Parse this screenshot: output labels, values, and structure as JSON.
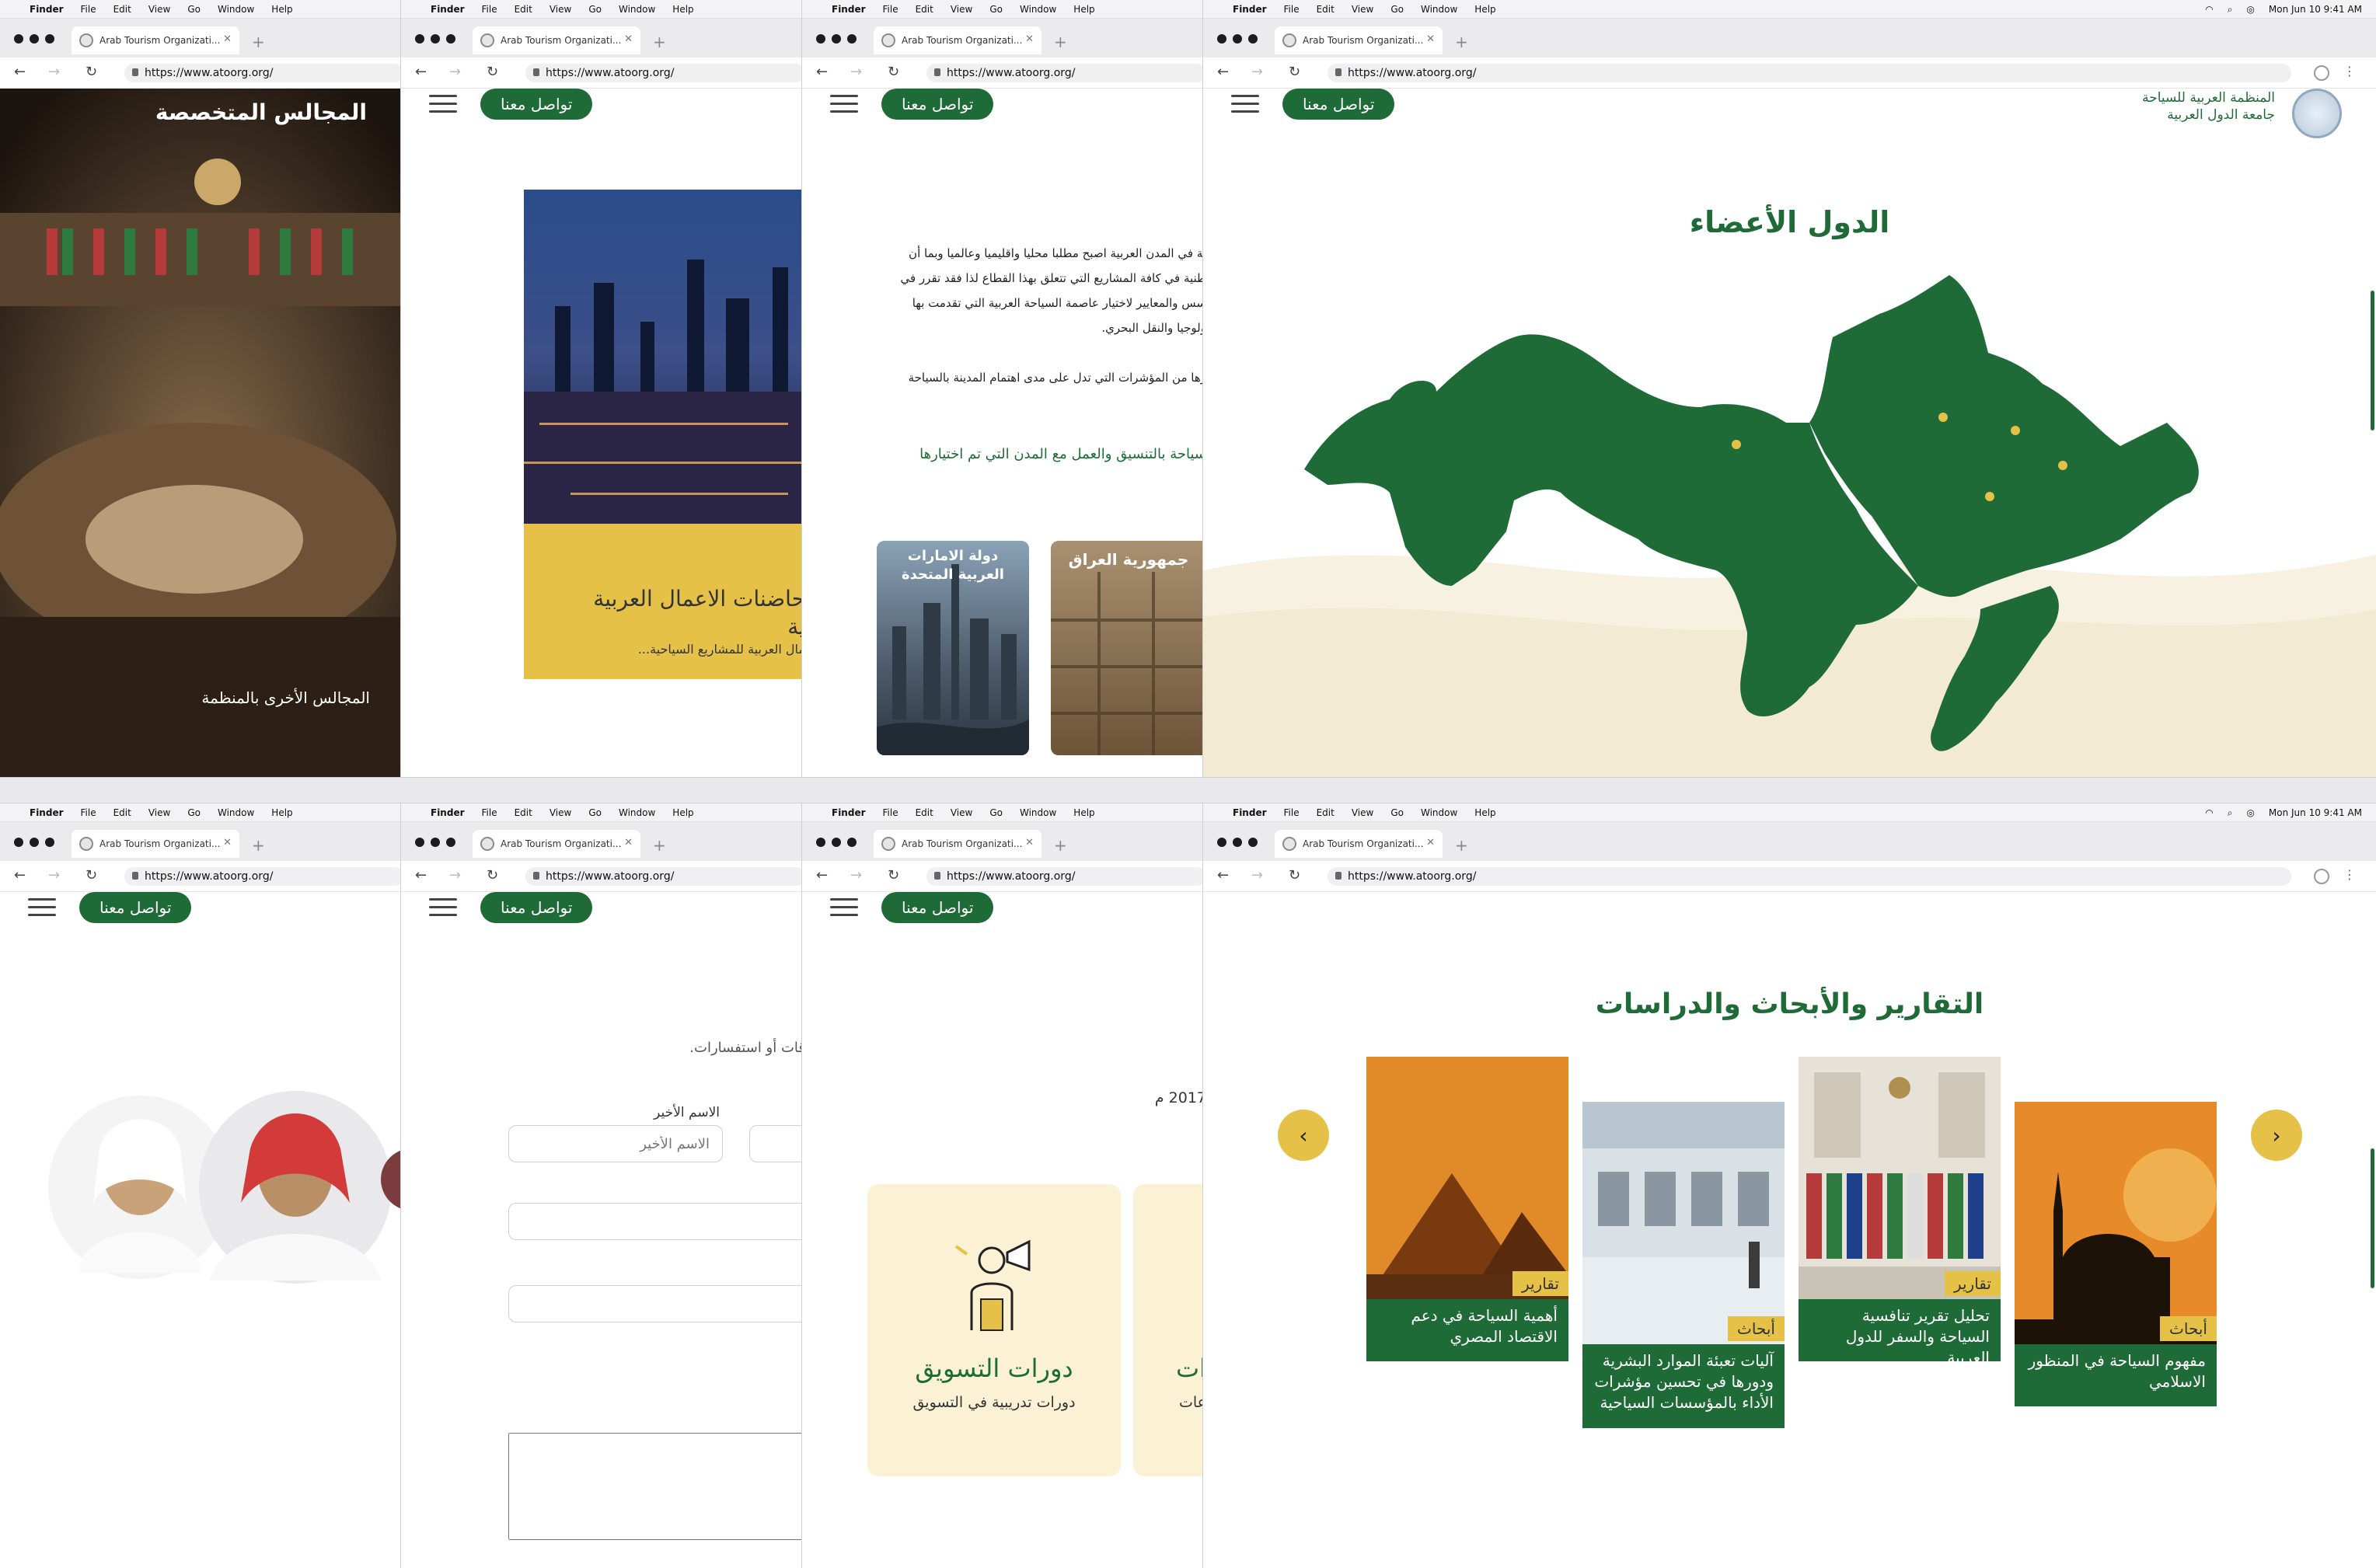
{
  "browser": {
    "menu": [
      "Finder",
      "File",
      "Edit",
      "View",
      "Go",
      "Window",
      "Help"
    ],
    "datetime": "Mon Jun 10  9:41 AM",
    "tab_title": "Arab Tourism Organizati...",
    "url": "https://www.atoorg.org/"
  },
  "site": {
    "contact_label": "تواصل معنا",
    "org_name_1": "المنظمة العربية للسياحة",
    "org_name_2": "جامعة الدول العربية"
  },
  "panel1": {
    "title": "المجالس المتخصصة",
    "caption": "المجالس الأخرى بالمنظمة"
  },
  "panel2": {
    "card_title_1": "حاضنات الاعمال العربية",
    "card_title_2": "ية",
    "card_desc": "مال العربية للمشاريع السياحية..."
  },
  "panel3": {
    "p1": "ية في المدن العربية اصبح مطلبا محليا واقليميا وعالميا وبما أن",
    "p2": "طنية في كافة المشاريع التي تتعلق بهذا القطاع لذا فقد تقرر في",
    "p3": "سس والمعايير لاختيار عاصمة السياحة العربية التي تقدمت بها",
    "p4": "ولوجيا والنقل البحري.",
    "p5": "رها من المؤشرات التي تدل على مدى اهتمام المدينة بالسياحة",
    "green_line": "سياحة بالتنسيق والعمل مع المدن التي تم اختيارها",
    "city_1": "جمهورية العراق",
    "city_2": "دولة الامارات العربية المتحدة"
  },
  "panel4": {
    "title": "الدول الأعضاء"
  },
  "panel6": {
    "intro": "قات أو استفسارات.",
    "last_name_label": "الاسم الأخير",
    "last_name_placeholder": "الاسم الأخير"
  },
  "panel7": {
    "year": "2017 م",
    "course_title": "دورات التسويق",
    "course_desc": "دورات تدريبية في التسويق",
    "course2_title": "ات",
    "course2_desc": "عات"
  },
  "panel8": {
    "title": "التقارير والأبحاث والدراسات",
    "cards": [
      {
        "tag": "تقارير",
        "text": "أهمية السياحة في دعم الاقتصاد المصري"
      },
      {
        "tag": "أبحاث",
        "text": "آليات تعبئة الموارد البشرية ودورها في تحسين مؤشرات الأداء بالمؤسسات السياحية"
      },
      {
        "tag": "تقارير",
        "text": "تحليل تقرير تنافسية السياحة والسفر للدول العربية"
      },
      {
        "tag": "أبحاث",
        "text": "مفهوم السياحة في المنظور الاسلامي"
      }
    ]
  },
  "colors": {
    "brand_green": "#1f6b37",
    "accent_gold": "#e5c247"
  }
}
